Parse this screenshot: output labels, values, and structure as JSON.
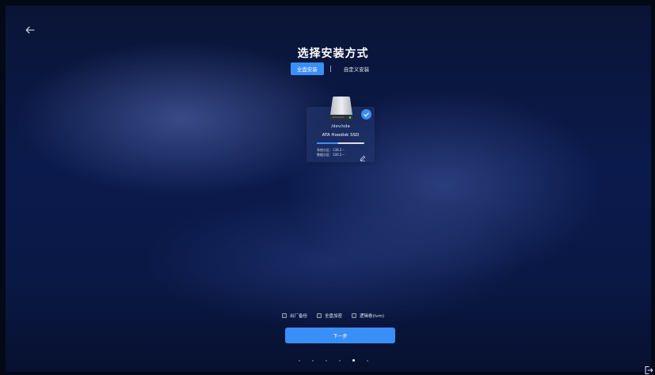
{
  "page": {
    "title": "选择安装方式",
    "tabs": [
      {
        "label": "全盘安装",
        "active": true
      },
      {
        "label": "自定义安装",
        "active": false
      }
    ]
  },
  "disk": {
    "path": "/dev/sda",
    "name": "ATA Hoodisk SSD",
    "selected": true,
    "usage_fraction": 0.45,
    "system_partition": "系统分区：138.2···",
    "data_partition": "数据分区：100.2···"
  },
  "options": [
    {
      "label": "出厂备份",
      "checked": false
    },
    {
      "label": "全盘加密",
      "checked": false
    },
    {
      "label": "逻辑卷(lvm)",
      "checked": false
    }
  ],
  "next_button": {
    "label": "下一步"
  },
  "pager": {
    "total": 6,
    "current": 5
  },
  "icons": {
    "back": "arrow-left-icon",
    "check": "checkmark-icon",
    "edit": "pencil-icon",
    "exit": "logout-icon",
    "disk": "hard-disk-icon"
  },
  "colors": {
    "accent": "#3a8ef7"
  }
}
